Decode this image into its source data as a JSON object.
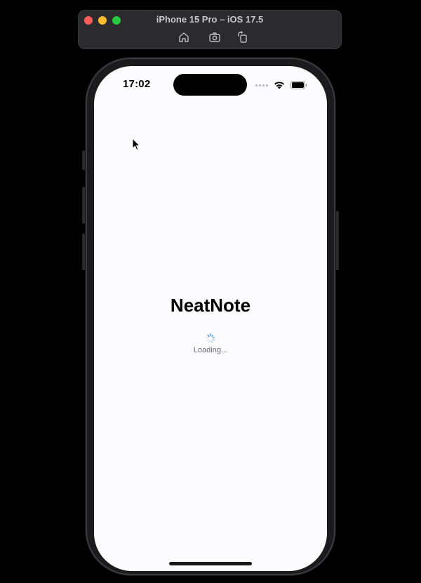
{
  "simulator": {
    "title": "iPhone 15 Pro – iOS 17.5",
    "toolbar": {
      "home_icon": "home-icon",
      "screenshot_icon": "camera-icon",
      "rotate_icon": "rotate-icon"
    }
  },
  "status_bar": {
    "time": "17:02",
    "wifi_icon": "wifi-icon",
    "battery_icon": "battery-icon"
  },
  "app": {
    "title": "NeatNote",
    "loading_text": "Loading...",
    "spinner_icon": "activity-spinner-icon"
  },
  "colors": {
    "screen_background": "#fcfbfe",
    "title_color": "#000000",
    "loading_text_color": "#6b6b70",
    "spinner_color": "#3b8fe0"
  }
}
